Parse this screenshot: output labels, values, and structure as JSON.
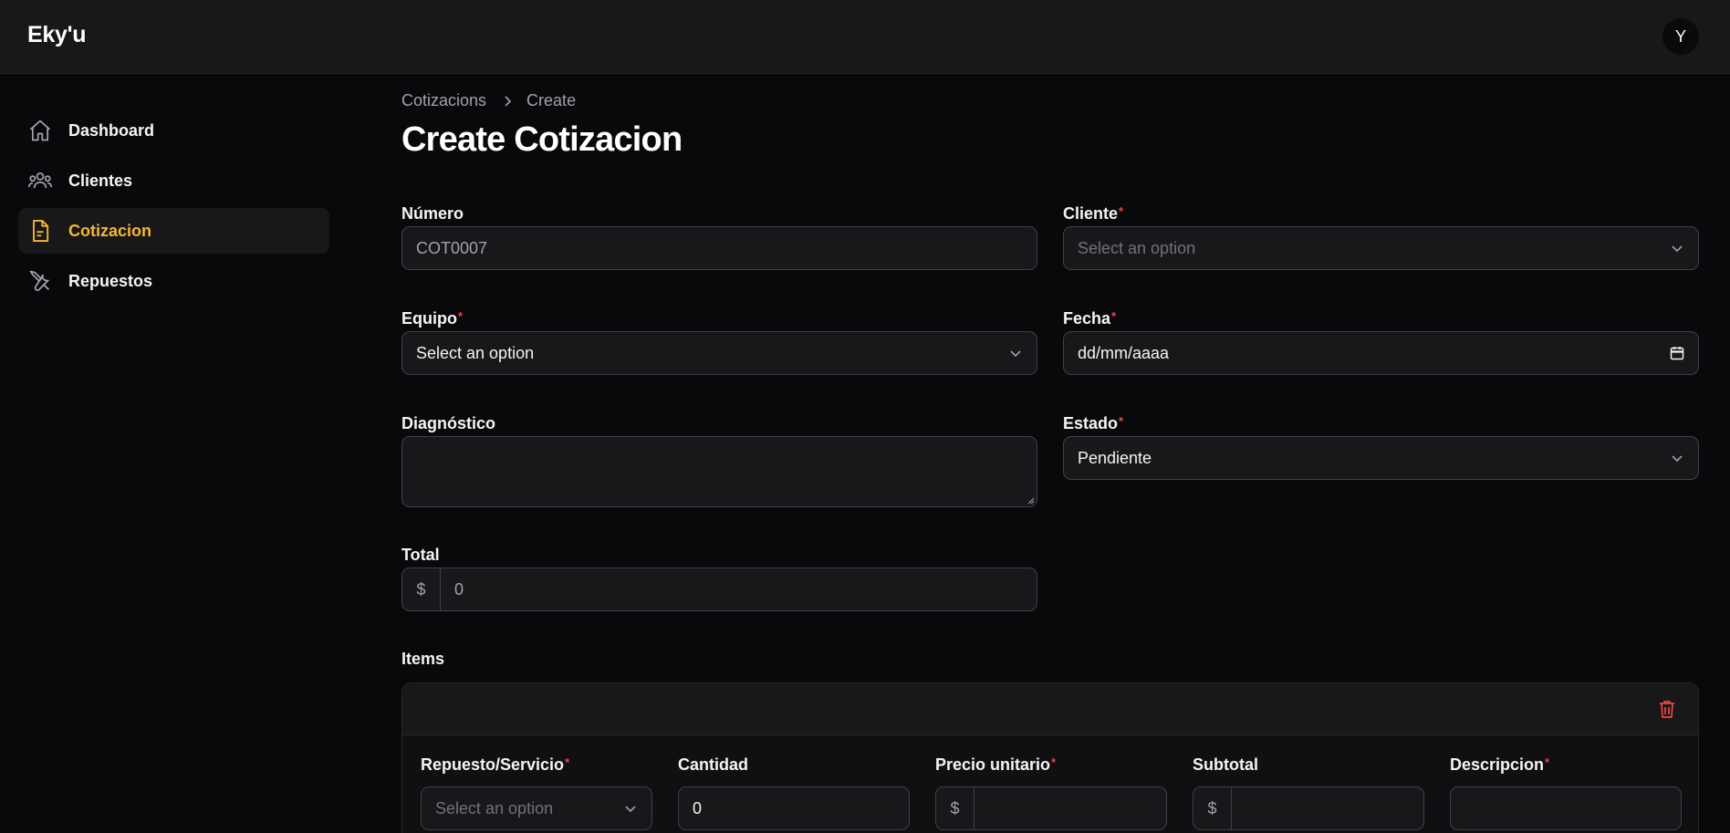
{
  "app": {
    "brand": "Eky'u",
    "user_initial": "Y"
  },
  "sidebar": {
    "items": [
      {
        "label": "Dashboard",
        "icon": "home-icon"
      },
      {
        "label": "Clientes",
        "icon": "users-icon"
      },
      {
        "label": "Cotizacion",
        "icon": "document-icon",
        "active": true
      },
      {
        "label": "Repuestos",
        "icon": "tools-icon"
      }
    ]
  },
  "breadcrumb": {
    "parent": "Cotizacions",
    "current": "Create"
  },
  "page": {
    "title": "Create Cotizacion"
  },
  "form": {
    "numero": {
      "label": "Número",
      "value": "COT0007"
    },
    "cliente": {
      "label": "Cliente",
      "placeholder": "Select an option"
    },
    "equipo": {
      "label": "Equipo",
      "placeholder": "Select an option"
    },
    "fecha": {
      "label": "Fecha",
      "placeholder": "dd/mm/aaaa"
    },
    "diagnostico": {
      "label": "Diagnóstico",
      "value": ""
    },
    "estado": {
      "label": "Estado",
      "value": "Pendiente"
    },
    "total": {
      "label": "Total",
      "prefix": "$",
      "value": "0"
    }
  },
  "items": {
    "label": "Items",
    "row": {
      "repuesto": {
        "label": "Repuesto/Servicio",
        "placeholder": "Select an option"
      },
      "cantidad": {
        "label": "Cantidad",
        "value": "0"
      },
      "precio": {
        "label": "Precio unitario",
        "prefix": "$",
        "value": ""
      },
      "subtotal": {
        "label": "Subtotal",
        "prefix": "$",
        "value": ""
      },
      "descripcion": {
        "label": "Descripcion",
        "value": ""
      }
    }
  },
  "required_marker": "*",
  "colors": {
    "accent": "#f5b731",
    "danger": "#ef4444",
    "background": "#09090b",
    "surface": "#18181b"
  }
}
